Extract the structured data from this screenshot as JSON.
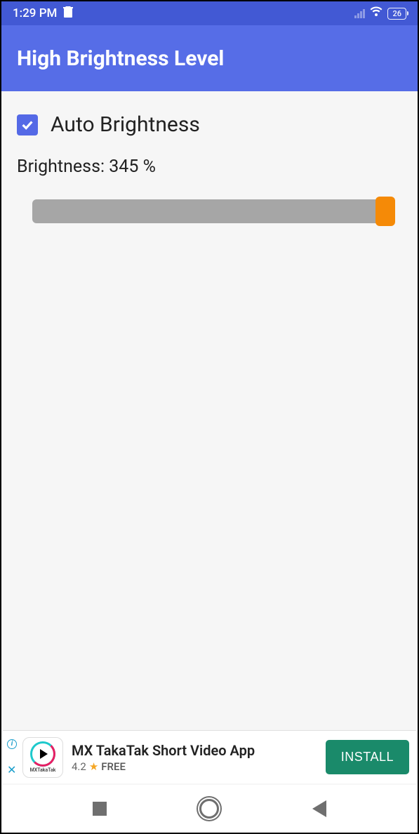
{
  "status": {
    "time": "1:29 PM",
    "battery": "26"
  },
  "app": {
    "title": "High Brightness Level"
  },
  "settings": {
    "auto_brightness_label": "Auto Brightness",
    "brightness_label": "Brightness: 345 %"
  },
  "ad": {
    "title": "MX TakaTak Short Video App",
    "rating": "4.2",
    "price": "FREE",
    "icon_label": "MXTakaTak",
    "install_label": "INSTALL"
  }
}
